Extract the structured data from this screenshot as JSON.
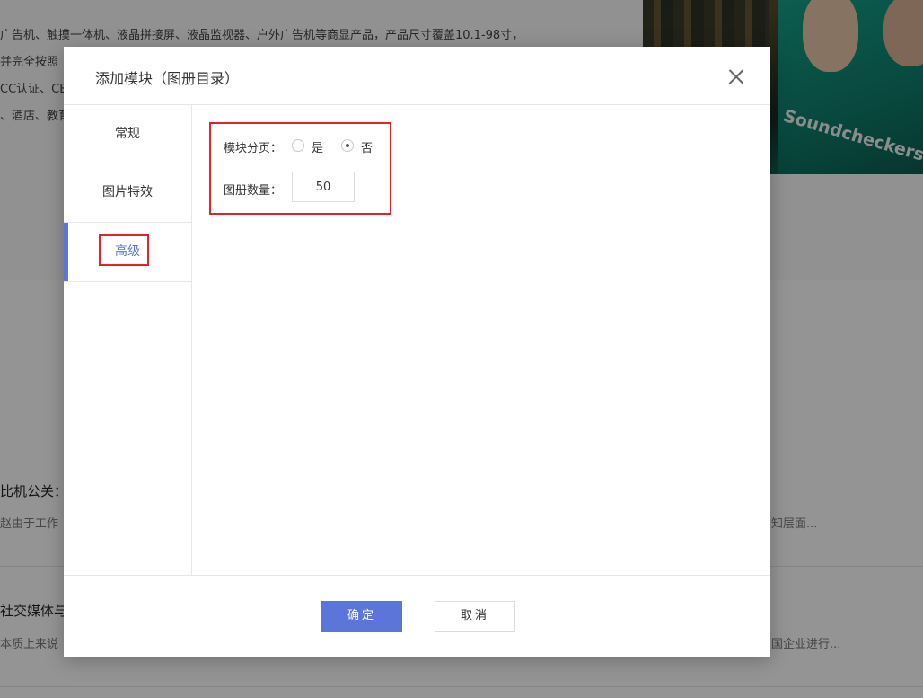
{
  "background": {
    "lines": [
      "广告机、触摸一体机、液晶拼接屏、液晶监视器、户外广告机等商显产品，产品尺寸覆盖10.1-98寸，",
      "并完全按照",
      "CC认证、CE",
      "、酒店、教育"
    ],
    "poster_text": "Soundcheckers",
    "article1_title": "比机公关：品",
    "article1_snippet": "赵由于工作",
    "article1_right": "知层面...",
    "article2_title": "社交媒体与企",
    "article2_snippet": "本质上来说",
    "article2_right": "国企业进行..."
  },
  "modal": {
    "title": "添加模块（图册目录）",
    "tabs": [
      {
        "label": "常规",
        "active": false
      },
      {
        "label": "图片特效",
        "active": false
      },
      {
        "label": "高级",
        "active": true
      }
    ],
    "pagination": {
      "label": "模块分页：",
      "options": [
        {
          "label": "是",
          "checked": false
        },
        {
          "label": "否",
          "checked": true
        }
      ]
    },
    "count": {
      "label": "图册数量：",
      "value": "50"
    },
    "buttons": {
      "ok": "确定",
      "cancel": "取消"
    }
  },
  "colors": {
    "accent": "#5b76d8",
    "highlight": "#e0242e",
    "overlay": "rgba(0,0,0,0.42)"
  }
}
